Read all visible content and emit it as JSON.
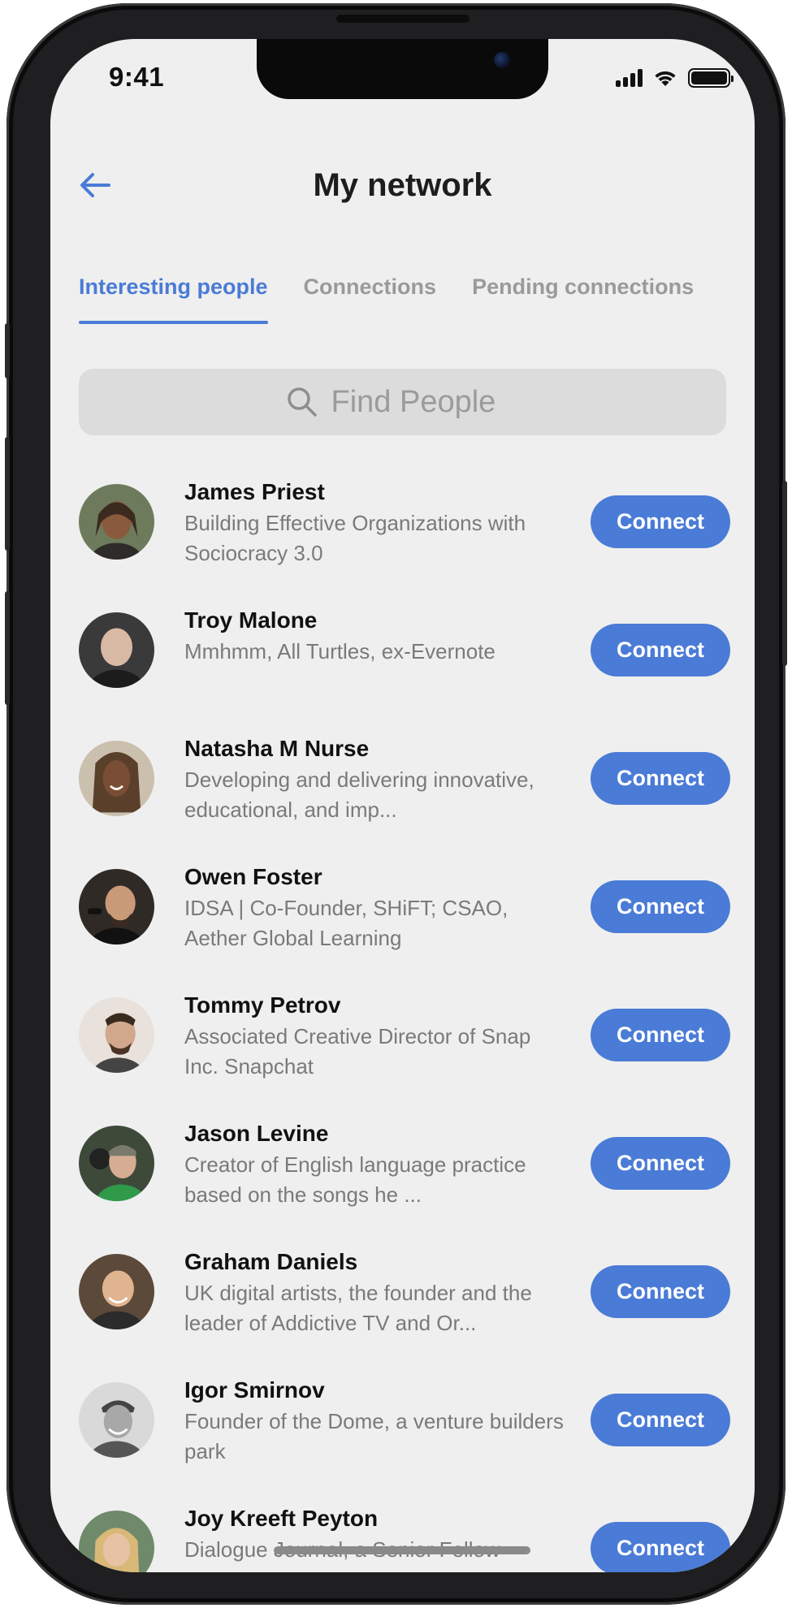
{
  "status_bar": {
    "time": "9:41"
  },
  "header": {
    "title": "My network"
  },
  "tabs": [
    {
      "label": "Interesting people",
      "active": true
    },
    {
      "label": "Connections",
      "active": false
    },
    {
      "label": "Pending connections",
      "active": false
    }
  ],
  "search": {
    "placeholder": "Find People"
  },
  "people": [
    {
      "name": "James Priest",
      "description": "Building Effective Organizations with Sociocracy 3.0",
      "button": "Connect"
    },
    {
      "name": "Troy Malone",
      "description": "Mmhmm, All Turtles, ex-Evernote",
      "button": "Connect"
    },
    {
      "name": "Natasha M Nurse",
      "description": "Developing and delivering innovative, educational, and imp...",
      "button": "Connect"
    },
    {
      "name": "Owen Foster",
      "description": "IDSA | Co-Founder, SHiFT; CSAO, Aether Global Learning",
      "button": "Connect"
    },
    {
      "name": "Tommy Petrov",
      "description": "Associated Creative Director of Snap Inc. Snapchat",
      "button": "Connect"
    },
    {
      "name": "Jason Levine",
      "description": "Creator of English language practice based on the songs he ...",
      "button": "Connect"
    },
    {
      "name": "Graham Daniels",
      "description": "UK digital artists, the founder and the leader of Addictive TV and Or...",
      "button": "Connect"
    },
    {
      "name": "Igor Smirnov",
      "description": "Founder of the Dome, a venture builders park",
      "button": "Connect"
    },
    {
      "name": "Joy Kreeft Peyton",
      "description": "Dialogue Journal, a Senior Fellow",
      "button": "Connect"
    }
  ],
  "colors": {
    "accent": "#4a7bd6",
    "background": "#efefef",
    "search_bg": "#dcdcdc"
  }
}
